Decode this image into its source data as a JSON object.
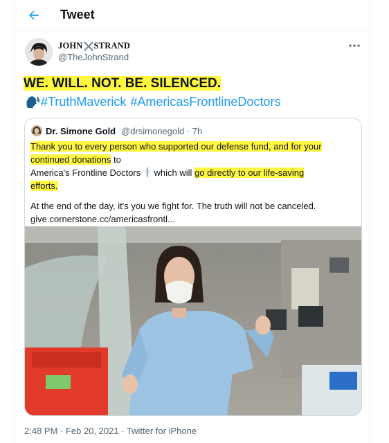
{
  "header": {
    "title": "Tweet"
  },
  "author": {
    "name_left": "JOHN",
    "name_right": "STRAND",
    "handle": "@TheJohnStrand"
  },
  "tweet": {
    "headline": "WE. WILL. NOT. BE. SILENCED.",
    "hashtags": [
      "#TruthMaverick",
      "#AmericasFrontlineDoctors"
    ]
  },
  "quoted": {
    "name": "Dr. Simone Gold",
    "handle_time": "@drsimonegold · 7h",
    "line1_hl": "Thank you to every person who supported our defense fund, and for your",
    "line2_hl": "continued donations",
    "line2_rest": " to",
    "line3_pre": "America's Frontline Doctors ",
    "line3_mid": " which will ",
    "line3_hl": "go directly to our life-saving",
    "line4_hl": "efforts.",
    "line5": "At the end of the day, it's you we fight for. The truth will not be canceled.",
    "line6": "give.cornerstone.cc/americasfrontl..."
  },
  "footer": {
    "timestamp": "2:48 PM · Feb 20, 2021 · Twitter for iPhone"
  },
  "colors": {
    "accent": "#1d9bf0",
    "highlight": "#fff740",
    "muted": "#536471"
  },
  "icons": {
    "back": "back-arrow-icon",
    "more": "more-options-icon",
    "speak": "speaking-head-icon",
    "medical": "medical-symbol-icon"
  }
}
